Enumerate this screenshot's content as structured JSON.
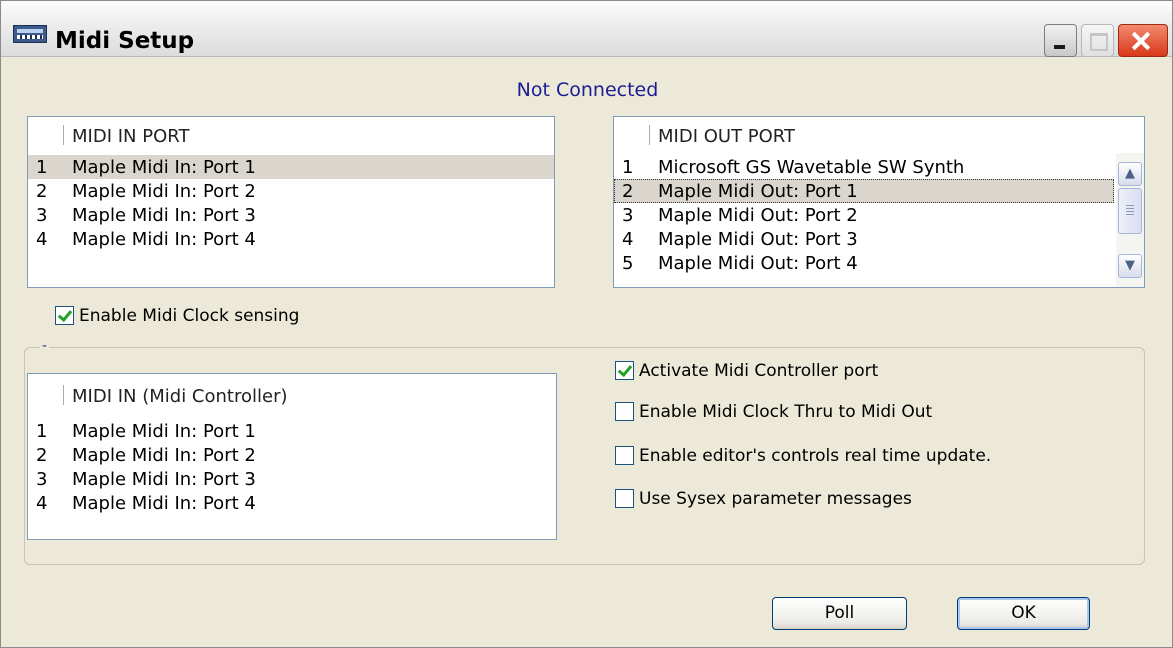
{
  "window": {
    "title": "Midi Setup"
  },
  "status": "Not Connected",
  "midi_in": {
    "header": "MIDI IN PORT",
    "items": [
      {
        "num": "1",
        "label": "Maple Midi In: Port 1"
      },
      {
        "num": "2",
        "label": "Maple Midi In: Port 2"
      },
      {
        "num": "3",
        "label": "Maple Midi In: Port 3"
      },
      {
        "num": "4",
        "label": "Maple Midi In: Port 4"
      }
    ],
    "selected": 1
  },
  "midi_out": {
    "header": "MIDI OUT PORT",
    "items": [
      {
        "num": "1",
        "label": "Microsoft GS Wavetable SW Synth"
      },
      {
        "num": "2",
        "label": "Maple Midi Out: Port 1"
      },
      {
        "num": "3",
        "label": "Maple Midi Out: Port 2"
      },
      {
        "num": "4",
        "label": "Maple Midi Out: Port 3"
      },
      {
        "num": "5",
        "label": "Maple Midi Out: Port 4"
      }
    ],
    "selected": 2
  },
  "clock_sensing": {
    "label": "Enable Midi Clock sensing",
    "checked": true
  },
  "controller_group": {
    "title": "-"
  },
  "midi_in_controller": {
    "header": "MIDI IN (Midi Controller)",
    "items": [
      {
        "num": "1",
        "label": "Maple Midi In: Port 1"
      },
      {
        "num": "2",
        "label": "Maple Midi In: Port 2"
      },
      {
        "num": "3",
        "label": "Maple Midi In: Port 3"
      },
      {
        "num": "4",
        "label": "Maple Midi In: Port 4"
      }
    ]
  },
  "options": {
    "activate_port": {
      "label": "Activate Midi Controller port",
      "checked": true
    },
    "clock_thru": {
      "label": "Enable Midi Clock Thru to Midi Out",
      "checked": false
    },
    "realtime_update": {
      "label": "Enable editor's controls real time update.",
      "checked": false
    },
    "sysex": {
      "label": "Use Sysex parameter messages",
      "checked": false
    }
  },
  "buttons": {
    "poll": "Poll",
    "ok": "OK"
  },
  "icons": {
    "app": "midi-app-icon",
    "minimize": "minimize-icon",
    "maximize": "maximize-icon",
    "close": "close-icon",
    "scroll_up": "chevron-up-icon",
    "scroll_down": "chevron-down-icon"
  },
  "colors": {
    "status_text": "#1c1c94",
    "check_mark": "#21a121",
    "close_button": "#d9381b"
  }
}
